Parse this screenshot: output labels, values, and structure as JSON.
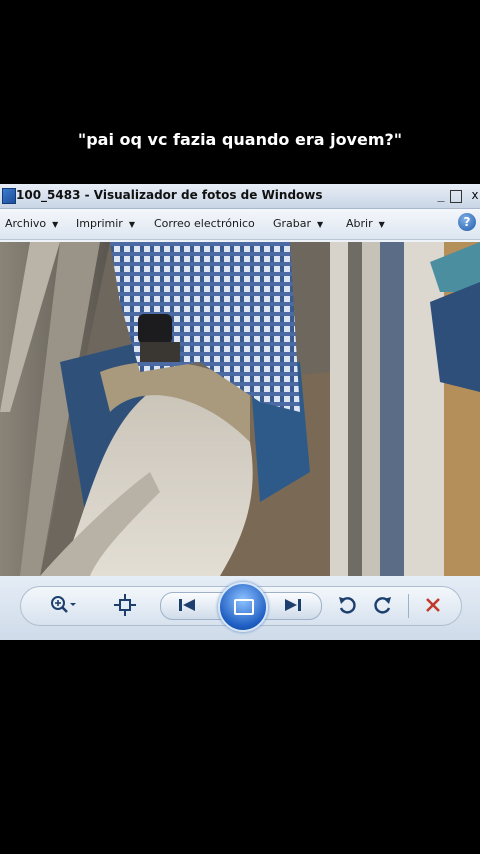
{
  "caption": "\"pai oq vc fazia quando era jovem?\"",
  "window": {
    "title": "100_5483 - Visualizador de fotos de Windows",
    "controls": {
      "minimize": "_",
      "maximize": "□",
      "close": "x"
    }
  },
  "menu": {
    "items": [
      {
        "label": "Archivo",
        "has_dropdown": true
      },
      {
        "label": "Imprimir",
        "has_dropdown": true
      },
      {
        "label": "Correo electrónico",
        "has_dropdown": false
      },
      {
        "label": "Grabar",
        "has_dropdown": true
      },
      {
        "label": "Abrir",
        "has_dropdown": true
      }
    ],
    "help_label": "?"
  },
  "photo": {
    "description_icon": "photo-of-rider-on-white-horse-in-chute"
  },
  "toolbar": {
    "buttons": [
      {
        "name": "zoom",
        "icon": "zoom-icon"
      },
      {
        "name": "actual-size",
        "icon": "actual-size-icon"
      },
      {
        "name": "previous",
        "icon": "previous-icon"
      },
      {
        "name": "slideshow",
        "icon": "slideshow-icon"
      },
      {
        "name": "next",
        "icon": "next-icon"
      },
      {
        "name": "rotate-left",
        "icon": "rotate-left-icon"
      },
      {
        "name": "rotate-right",
        "icon": "rotate-right-icon"
      },
      {
        "name": "delete",
        "icon": "delete-icon"
      }
    ]
  },
  "colors": {
    "background": "#000000",
    "window_bg": "#eef3f9",
    "accent": "#1d5dc2",
    "delete": "#c0392b"
  }
}
